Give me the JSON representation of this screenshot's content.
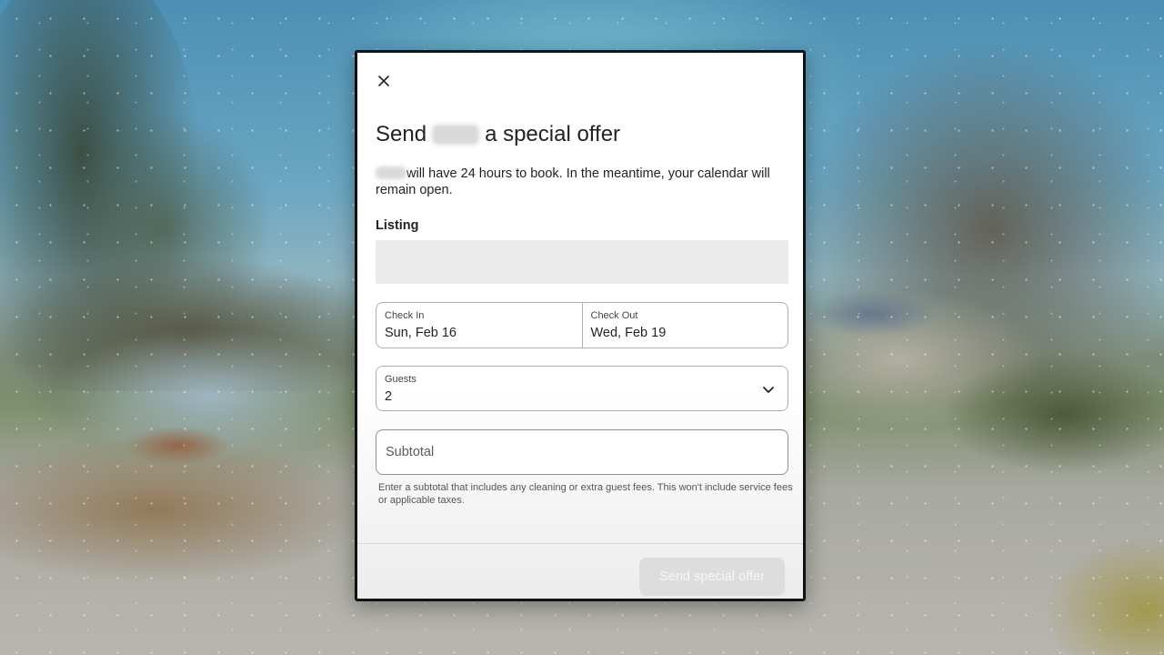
{
  "dialog": {
    "close_icon": "close-icon",
    "title_prefix": "Send",
    "title_suffix": "a special offer",
    "description": "will have 24 hours to book. In the meantime, your calendar will remain open.",
    "listing_label": "Listing",
    "check_in": {
      "label": "Check In",
      "value": "Sun, Feb 16"
    },
    "check_out": {
      "label": "Check Out",
      "value": "Wed, Feb 19"
    },
    "guests": {
      "label": "Guests",
      "value": "2",
      "icon": "chevron-down-icon"
    },
    "subtotal": {
      "placeholder": "Subtotal",
      "value": ""
    },
    "hint": "Enter a subtotal that includes any cleaning or extra guest fees. This won't include service fees or applicable taxes.",
    "send_button": "Send special offer"
  }
}
